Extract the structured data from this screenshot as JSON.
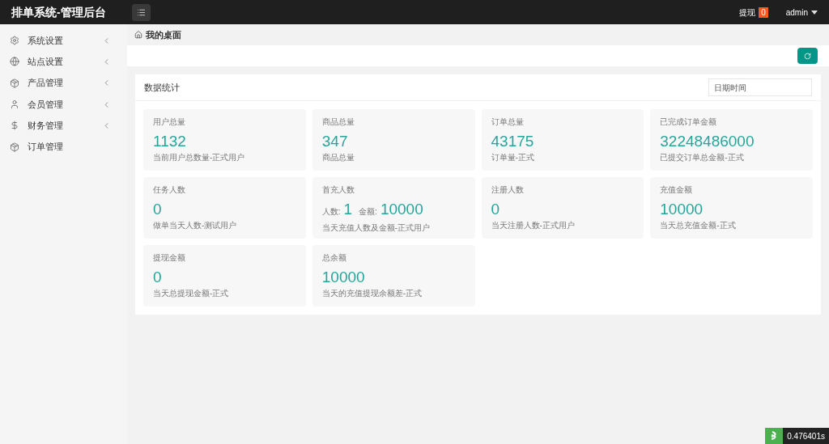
{
  "header": {
    "title": "排单系统-管理后台",
    "withdraw_label": "提现",
    "withdraw_count": "0",
    "user": "admin"
  },
  "sidebar": {
    "items": [
      {
        "label": "系统设置",
        "expandable": true
      },
      {
        "label": "站点设置",
        "expandable": true
      },
      {
        "label": "产品管理",
        "expandable": true
      },
      {
        "label": "会员管理",
        "expandable": true
      },
      {
        "label": "财务管理",
        "expandable": true
      },
      {
        "label": "订单管理",
        "expandable": false
      }
    ]
  },
  "breadcrumb": "我的桌面",
  "panel": {
    "title": "数据统计",
    "date_placeholder": "日期时间",
    "cards": [
      {
        "kind": "plain",
        "label": "用户总量",
        "value": "1132",
        "note": "当前用户总数量-正式用户"
      },
      {
        "kind": "plain",
        "label": "商品总量",
        "value": "347",
        "note": "商品总量"
      },
      {
        "kind": "plain",
        "label": "订单总量",
        "value": "43175",
        "note": "订单量-正式"
      },
      {
        "kind": "plain",
        "label": "已完成订单金额",
        "value": "32248486000",
        "note": "已提交订单总金额-正式"
      },
      {
        "kind": "plain",
        "label": "任务人数",
        "value": "0",
        "note": "做单当天人数-测试用户"
      },
      {
        "kind": "pair",
        "label": "首充人数",
        "parts": [
          {
            "label": "人数:",
            "value": "1"
          },
          {
            "label": "金额:",
            "value": "10000"
          }
        ],
        "note": "当天充值人数及金额-正式用户"
      },
      {
        "kind": "plain",
        "label": "注册人数",
        "value": "0",
        "note": "当天注册人数-正式用户"
      },
      {
        "kind": "plain",
        "label": "充值金额",
        "value": "10000",
        "note": "当天总充值金额-正式"
      },
      {
        "kind": "plain",
        "label": "提现金额",
        "value": "0",
        "note": "当天总提现金额-正式"
      },
      {
        "kind": "plain",
        "label": "总余额",
        "value": "10000",
        "note": "当天的充值提现余额差-正式"
      }
    ]
  },
  "trace": "0.476401s"
}
